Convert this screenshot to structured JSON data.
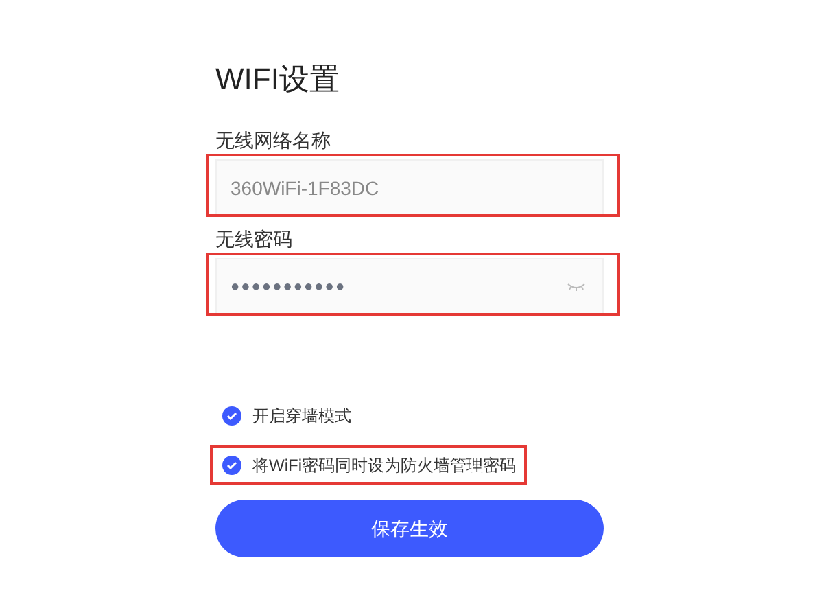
{
  "title": "WIFI设置",
  "fields": [
    {
      "label": "无线网络名称",
      "value": "360WiFi-1F83DC",
      "kind": "text",
      "highlighted": true
    },
    {
      "label": "无线密码",
      "value": "●●●●●●●●●●●",
      "kind": "password",
      "highlighted": true
    }
  ],
  "options": [
    {
      "label": "开启穿墙模式",
      "checked": true,
      "highlighted": false
    },
    {
      "label": "将WiFi密码同时设为防火墙管理密码",
      "checked": true,
      "highlighted": true
    }
  ],
  "button": "保存生效"
}
